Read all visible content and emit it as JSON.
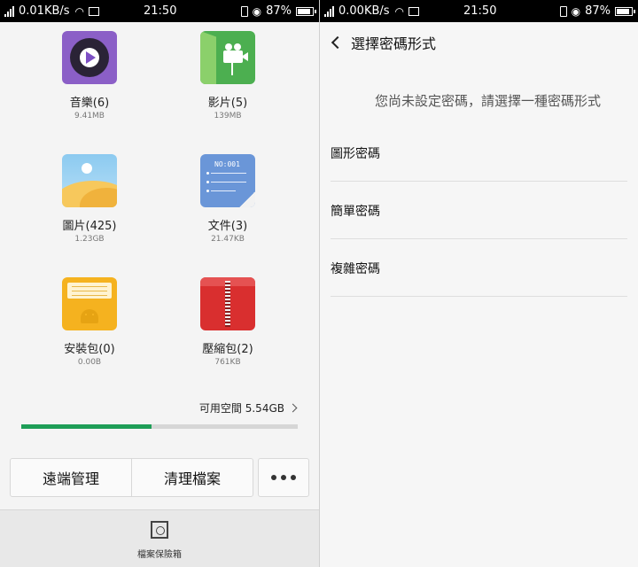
{
  "left": {
    "status": {
      "rate": "0.01KB/s",
      "time": "21:50",
      "battery": "87%"
    },
    "categories": [
      {
        "name": "音樂(6)",
        "size": "9.41MB"
      },
      {
        "name": "影片(5)",
        "size": "139MB"
      },
      {
        "name": "圖片(425)",
        "size": "1.23GB"
      },
      {
        "name": "文件(3)",
        "size": "21.47KB"
      },
      {
        "name": "安裝包(0)",
        "size": "0.00B"
      },
      {
        "name": "壓縮包(2)",
        "size": "761KB"
      }
    ],
    "doc_icon_text": "NO:001",
    "free_space": "可用空間 5.54GB",
    "storage_used_fraction": 0.47,
    "buttons": {
      "remote": "遠端管理",
      "clean": "清理檔案"
    },
    "vault_label": "檔案保險箱",
    "colors": {
      "progress": "#1e9e57"
    }
  },
  "right": {
    "status": {
      "rate": "0.00KB/s",
      "time": "21:50",
      "battery": "87%"
    },
    "title": "選擇密碼形式",
    "hint": "您尚未設定密碼，請選擇一種密碼形式",
    "options": [
      "圖形密碼",
      "簡單密碼",
      "複雜密碼"
    ]
  }
}
